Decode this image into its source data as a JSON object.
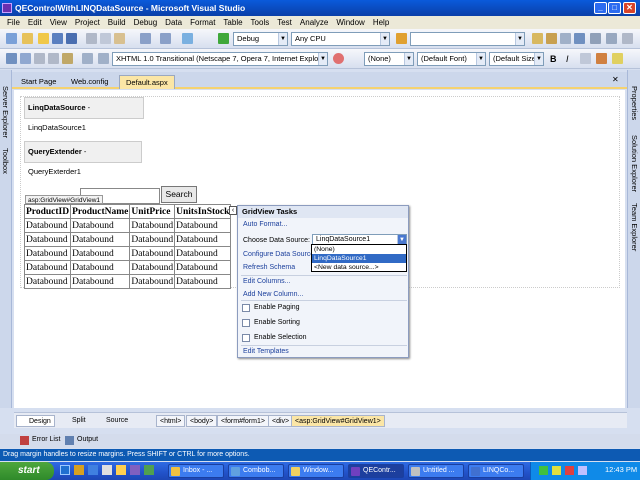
{
  "window": {
    "title": "QEControlWithLINQDataSource - Microsoft Visual Studio",
    "minimize_glyph": "_",
    "maximize_glyph": "□",
    "close_glyph": "✕"
  },
  "menu": [
    "File",
    "Edit",
    "View",
    "Project",
    "Build",
    "Debug",
    "Data",
    "Format",
    "Table",
    "Tools",
    "Test",
    "Analyze",
    "Window",
    "Help"
  ],
  "toolbar": {
    "config": "Debug",
    "platform": "Any CPU",
    "doctype": "XHTML 1.0 Transitional (Netscape 7, Opera 7, Internet Explorer 6)",
    "style_block": "(None)",
    "font_name": "(Default Font)",
    "font_size": "(Default Size)",
    "bold": "B",
    "italic": "I"
  },
  "left_rail": [
    "Server Explorer",
    "Toolbox"
  ],
  "right_rail": [
    "Properties",
    "Solution Explorer",
    "Team Explorer"
  ],
  "tabs": [
    "Start Page",
    "Web.config",
    "Default.aspx"
  ],
  "design": {
    "linq_source": {
      "type": "LinqDataSource",
      "id": "- LinqDataSource1"
    },
    "query_extender": {
      "type": "QueryExtender",
      "id": "- QueryExterder1"
    },
    "search_button": "Search",
    "grid_tag": "asp:GridView#GridView1",
    "grid_columns": [
      "ProductID",
      "ProductName",
      "UnitPrice",
      "UnitsInStock"
    ],
    "grid_rows": [
      [
        "Databound",
        "Databound",
        "Databound",
        "Databound"
      ],
      [
        "Databound",
        "Databound",
        "Databound",
        "Databound"
      ],
      [
        "Databound",
        "Databound",
        "Databound",
        "Databound"
      ],
      [
        "Databound",
        "Databound",
        "Databound",
        "Databound"
      ],
      [
        "Databound",
        "Databound",
        "Databound",
        "Databound"
      ]
    ]
  },
  "tasks": {
    "title": "GridView Tasks",
    "smart_tag_glyph": "‹",
    "auto_format": "Auto Format...",
    "choose_label": "Choose Data Source:",
    "choose_value": "LinqDataSource1",
    "configure": "Configure Data Source...",
    "refresh": "Refresh Schema",
    "edit_columns": "Edit Columns...",
    "add_column": "Add New Column...",
    "paging": "Enable Paging",
    "sorting": "Enable Sorting",
    "selection": "Enable Selection",
    "edit_templates": "Edit Templates",
    "dropdown_options": [
      "(None)",
      "LinqDataSource1",
      "<New data source...>"
    ]
  },
  "view_tabs": [
    "Design",
    "Split",
    "Source"
  ],
  "tag_nav": [
    "<html>",
    "<body>",
    "<form#form1>",
    "<div>",
    "<asp:GridView#GridView1>"
  ],
  "bottom_panels": [
    "Error List",
    "Output"
  ],
  "status": "Drag margin handles to resize margins. Press SHIFT or CTRL for more options.",
  "taskbar": {
    "start": "start",
    "tasks": [
      "Inbox - ...",
      "Combob...",
      "Window...",
      "QEContr...",
      "Untitled ...",
      "LINQCo..."
    ],
    "clock": "12:43 PM"
  },
  "colors": {
    "accent": "#0a5adb",
    "tab_active": "#fbe6a6",
    "link": "#1b3f9c",
    "selection": "#316ac5"
  }
}
